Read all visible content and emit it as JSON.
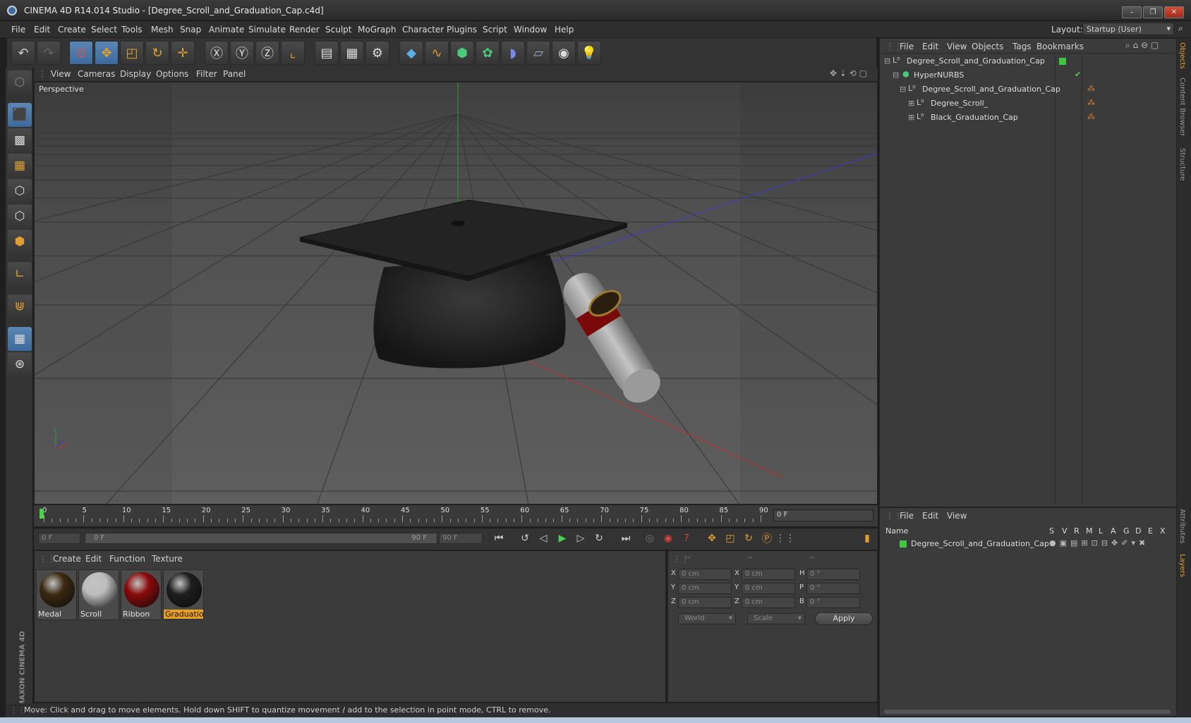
{
  "window": {
    "title": "CINEMA 4D R14.014 Studio - [Degree_Scroll_and_Graduation_Cap.c4d]"
  },
  "menu": [
    "File",
    "Edit",
    "Create",
    "Select",
    "Tools",
    "Mesh",
    "Snap",
    "Animate",
    "Simulate",
    "Render",
    "Sculpt",
    "MoGraph",
    "Character",
    "Plugins",
    "Script",
    "Window",
    "Help"
  ],
  "layout": {
    "label": "Layout:",
    "value": "Startup (User)"
  },
  "viewport": {
    "menu": [
      "View",
      "Cameras",
      "Display",
      "Options",
      "Filter",
      "Panel"
    ],
    "label": "Perspective"
  },
  "timeline": {
    "ticks": [
      "0",
      "5",
      "10",
      "15",
      "20",
      "25",
      "30",
      "35",
      "40",
      "45",
      "50",
      "55",
      "60",
      "65",
      "70",
      "75",
      "80",
      "85",
      "90"
    ],
    "current": "0 F",
    "start": "0 F",
    "range_start": "0 F",
    "range_end": "90 F",
    "end": "90 F"
  },
  "materials": {
    "menu": [
      "Create",
      "Edit",
      "Function",
      "Texture"
    ],
    "items": [
      {
        "name": "Medal",
        "color": "#3a2a10"
      },
      {
        "name": "Scroll",
        "color": "#bdbdbd"
      },
      {
        "name": "Ribbon",
        "color": "#8a0a0a"
      },
      {
        "name": "Graduation",
        "color": "#1e1e1e"
      }
    ]
  },
  "coords": {
    "headers": [
      "--",
      "--",
      "--"
    ],
    "rows": [
      {
        "a": "X",
        "av": "0 cm",
        "b": "X",
        "bv": "0 cm",
        "c": "H",
        "cv": "0 °"
      },
      {
        "a": "Y",
        "av": "0 cm",
        "b": "Y",
        "bv": "0 cm",
        "c": "P",
        "cv": "0 °"
      },
      {
        "a": "Z",
        "av": "0 cm",
        "b": "Z",
        "bv": "0 cm",
        "c": "B",
        "cv": "0 °"
      }
    ],
    "world": "World",
    "scale": "Scale",
    "apply": "Apply"
  },
  "objects": {
    "menu": [
      "File",
      "Edit",
      "View",
      "Objects",
      "Tags",
      "Bookmarks"
    ],
    "items": [
      "Degree_Scroll_and_Graduation_Cap",
      "HyperNURBS",
      "Degree_Scroll_and_Graduation_Cap",
      "Degree_Scroll_",
      "Black_Graduation_Cap"
    ]
  },
  "layers": {
    "menu": [
      "File",
      "Edit",
      "View"
    ],
    "name_header": "Name",
    "cols": [
      "S",
      "V",
      "R",
      "M",
      "L",
      "A",
      "G",
      "D",
      "E",
      "X"
    ],
    "item": "Degree_Scroll_and_Graduation_Cap"
  },
  "side_tabs": [
    "Objects",
    "Content Browser",
    "Structure",
    "Attributes",
    "Layers"
  ],
  "status": "Move: Click and drag to move elements. Hold down SHIFT to quantize movement / add to the selection in point mode, CTRL to remove.",
  "logo": "MAXON CINEMA 4D"
}
